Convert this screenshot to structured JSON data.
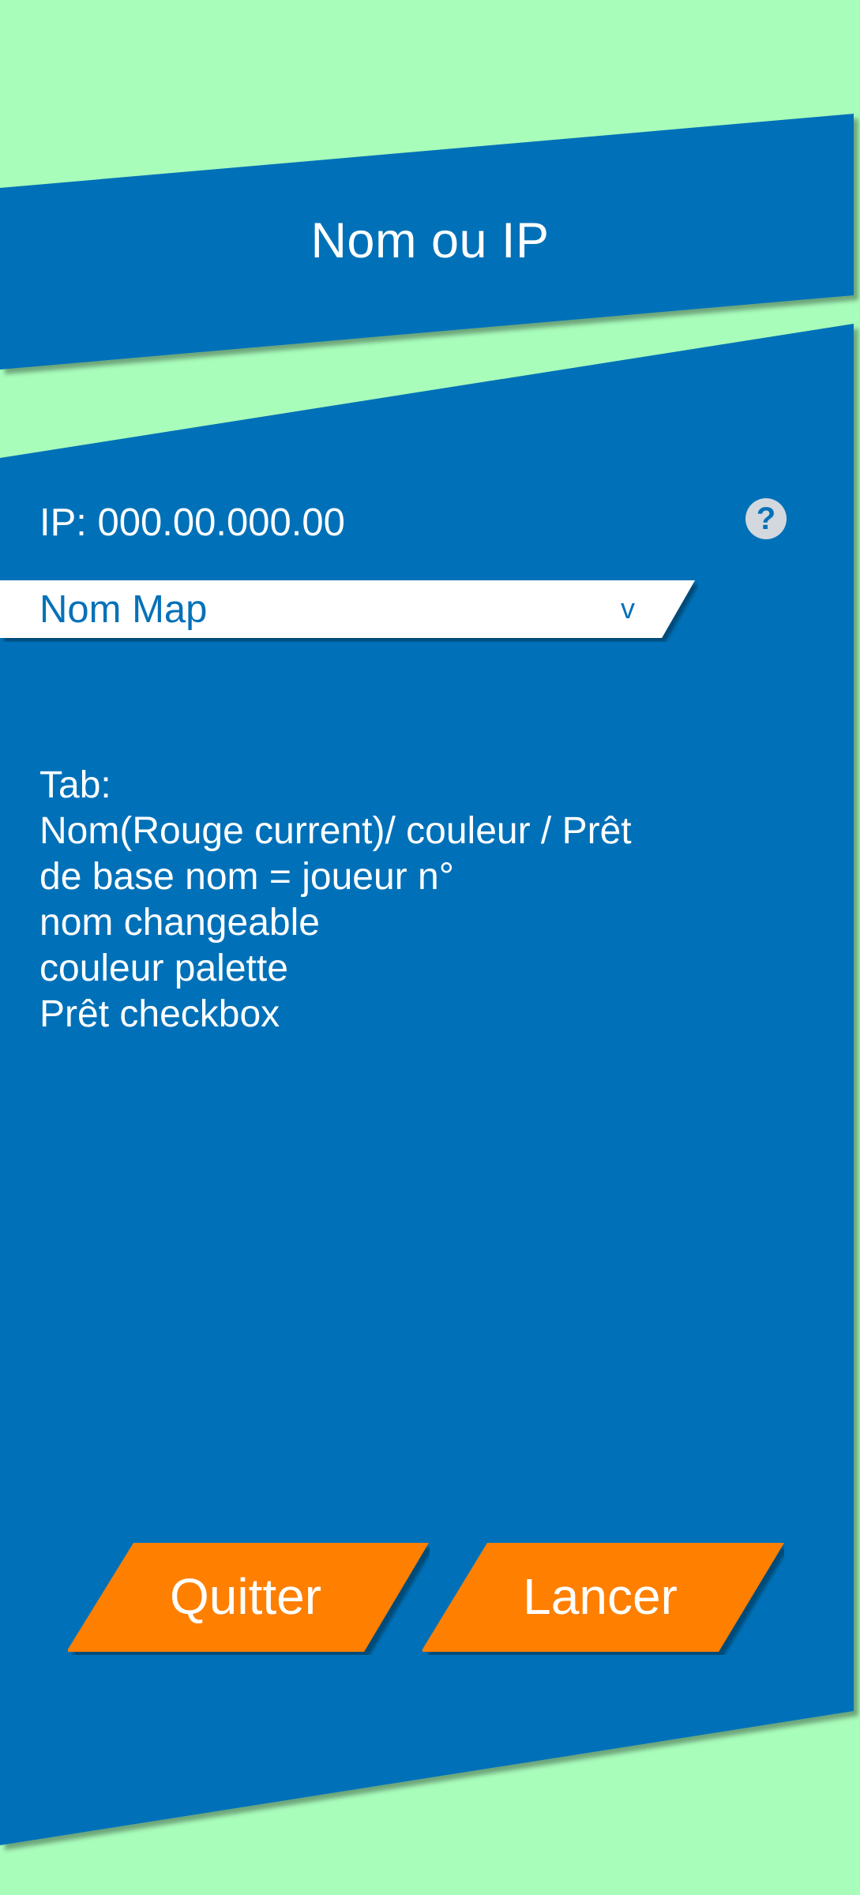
{
  "colors": {
    "background": "#A8FDBB",
    "panel": "#0671B8",
    "accent": "#FF7F00",
    "text": "#FFFFFF",
    "help_icon_bg": "#D2D8DE"
  },
  "header": {
    "title": "Nom ou IP"
  },
  "server": {
    "ip_label": "IP: 000.00.000.00",
    "help_symbol": "?"
  },
  "map_select": {
    "value": "Nom Map",
    "chevron": "v"
  },
  "notes": {
    "lines": [
      "Tab:",
      "Nom(Rouge current)/ couleur / Prêt",
      "de base nom = joueur n°",
      "nom changeable",
      "couleur palette",
      "Prêt checkbox"
    ]
  },
  "actions": {
    "quit_label": "Quitter",
    "launch_label": "Lancer"
  }
}
